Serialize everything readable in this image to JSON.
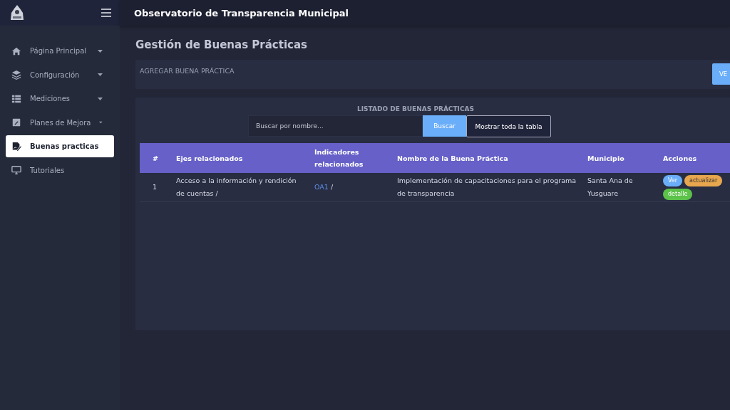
{
  "app": {
    "title": "Observatorio de Transparencia Municipal"
  },
  "sidebar": {
    "items": [
      {
        "label": "Página Principal",
        "kind": "home",
        "expandable": true,
        "selected": false
      },
      {
        "label": "Configuración",
        "kind": "layers",
        "expandable": true,
        "selected": false
      },
      {
        "label": "Mediciones",
        "kind": "grid",
        "expandable": true,
        "selected": false
      },
      {
        "label": "Planes de Mejora",
        "kind": "edit",
        "expandable": true,
        "selected": false
      },
      {
        "label": "Buenas practicas",
        "kind": "document",
        "expandable": false,
        "selected": true
      },
      {
        "label": "Tutoriales",
        "kind": "monitor",
        "expandable": false,
        "selected": false
      }
    ]
  },
  "page": {
    "heading": "Gestión de Buenas Prácticas",
    "add_panel": {
      "label": "AGREGAR BUENA PRÁCTICA",
      "button": "VE"
    },
    "list": {
      "title": "LISTADO DE BUENAS PRÁCTICAS",
      "search": {
        "placeholder": "Buscar por nombre..."
      },
      "search_button": "Buscar",
      "show_all_button": "Mostrar toda la tabla",
      "table": {
        "columns": [
          "#",
          "Ejes relacionados",
          "Indicadores relacionados",
          "Nombre de la Buena Práctica",
          "Municipio",
          "Acciones"
        ],
        "rows": [
          {
            "number": "1",
            "axes": "Acceso a la información y rendición de cuentas /",
            "indicator_link": "OA1",
            "indicator_sep": "/",
            "name": "Implementación de capacitaciones para el programa de transparencia",
            "municipality": "Santa Ana de Yusguare",
            "actions": [
              {
                "label": "Ver",
                "kind": "view"
              },
              {
                "label": "actualizar",
                "kind": "update"
              },
              {
                "label": "detalle",
                "kind": "detail"
              }
            ]
          }
        ]
      }
    }
  }
}
